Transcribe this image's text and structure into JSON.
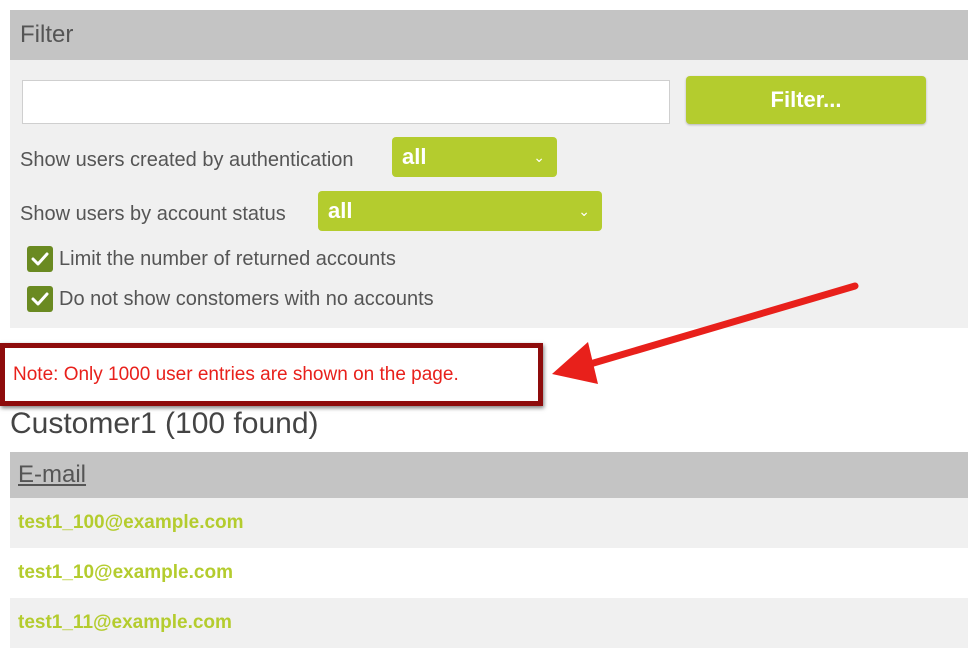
{
  "filter": {
    "header": "Filter",
    "search_value": "",
    "button_label": "Filter...",
    "auth_label": "Show users created by authentication",
    "auth_selected": "all",
    "status_label": "Show users by account status",
    "status_selected": "all",
    "checkboxes": [
      {
        "label": "Limit the number of returned accounts",
        "checked": true
      },
      {
        "label": "Do not show constomers with no accounts",
        "checked": true
      }
    ]
  },
  "note": "Note: Only 1000 user entries are shown on the page.",
  "section_title": "Customer1 (100 found)",
  "table": {
    "column_header": "E-mail",
    "rows": [
      "test1_100@example.com",
      "test1_10@example.com",
      "test1_11@example.com"
    ]
  },
  "colors": {
    "accent": "#b4cc2e",
    "checkbox": "#6a8a21",
    "header_bg": "#c4c4c4",
    "panel_bg": "#f0f0f0",
    "note_text": "#e8201b",
    "note_border": "#8e0c0c",
    "arrow": "#e8201b"
  }
}
